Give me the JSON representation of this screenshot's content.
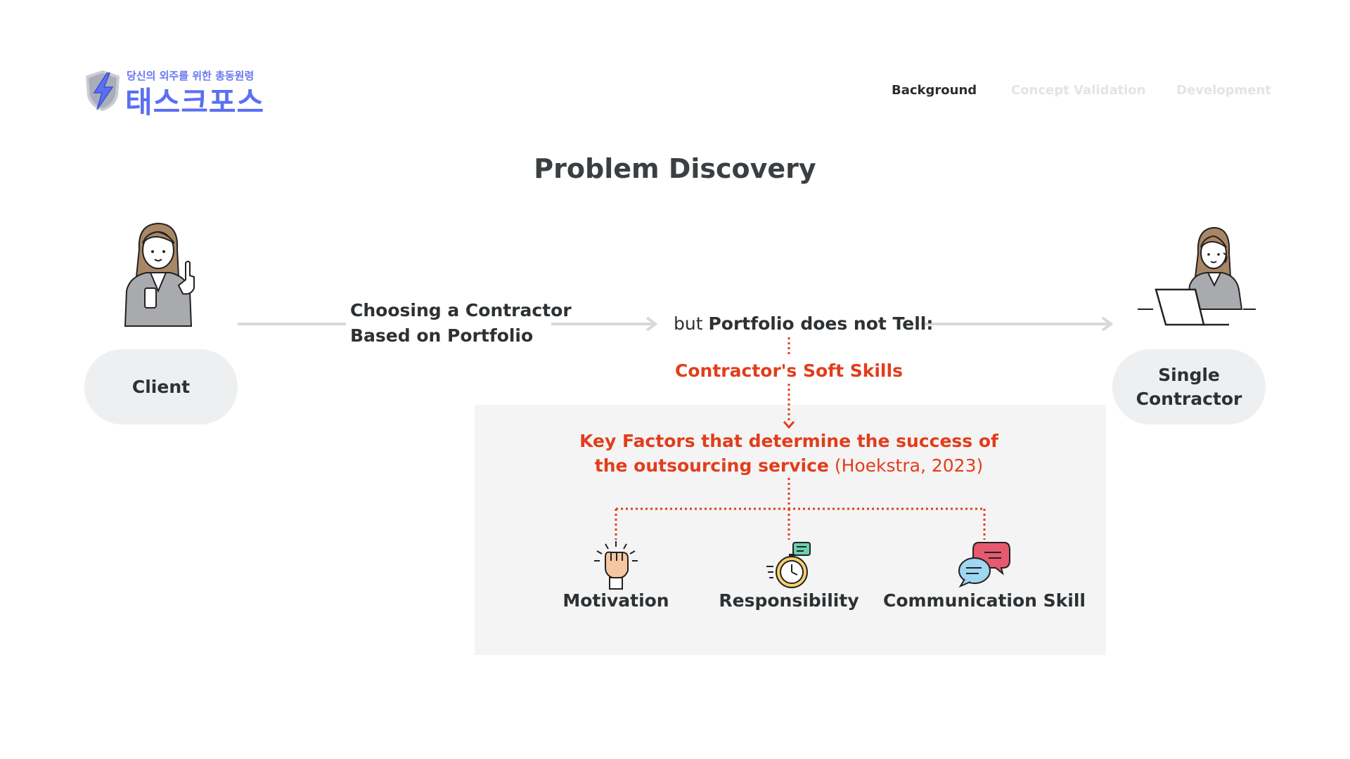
{
  "logo": {
    "tagline": "당신의 외주를 위한 총동원령",
    "name": "태스크포스"
  },
  "nav": {
    "items": [
      "Background",
      "Concept Validation",
      "Development"
    ],
    "active": "Background"
  },
  "title": "Problem Discovery",
  "client": {
    "label": "Client"
  },
  "contractor": {
    "label_line1": "Single",
    "label_line2": "Contractor"
  },
  "step1": {
    "line1": "Choosing a Contractor",
    "line2": "Based on Portfolio"
  },
  "step2": {
    "prefix": "but ",
    "bold": "Portfolio does not Tell:"
  },
  "soft_skills": "Contractor's Soft Skills",
  "key_factors": {
    "line1": "Key Factors that determine the success of",
    "line2_bold": "the outsourcing service",
    "citation": " (Hoekstra, 2023)"
  },
  "factors": [
    {
      "label": "Motivation",
      "icon": "raised-fist-icon"
    },
    {
      "label": "Responsibility",
      "icon": "stopwatch-icon"
    },
    {
      "label": "Communication Skill",
      "icon": "speech-bubbles-icon"
    }
  ],
  "colors": {
    "accent_red": "#e23d1c",
    "brand_blue": "#5b6ff2",
    "pill_gray": "#eeeff1",
    "panel_gray": "#f4f4f4"
  }
}
